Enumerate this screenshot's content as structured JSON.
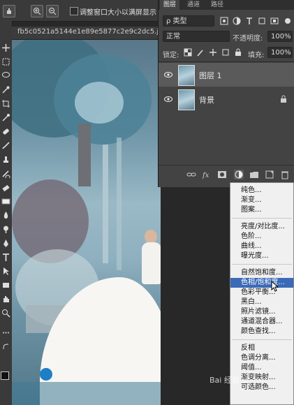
{
  "options_bar": {
    "checkbox_label": "调整窗口大小以满屏显示"
  },
  "document": {
    "tab_title": "fb5c0521a5144e1e89e5877c2e9c2dc5.jpg @"
  },
  "layers_panel": {
    "tabs": [
      "图层",
      "通道",
      "路径"
    ],
    "filter_label": "ρ 类型",
    "blend_mode": "正常",
    "opacity_label": "不透明度:",
    "opacity_value": "100%",
    "lock_label": "锁定:",
    "fill_label": "填充:",
    "fill_value": "100%",
    "layers": [
      {
        "name": "图层 1",
        "selected": true,
        "locked": false
      },
      {
        "name": "背景",
        "selected": false,
        "locked": true
      }
    ]
  },
  "adjustment_menu": {
    "groups": [
      [
        "纯色...",
        "渐变...",
        "图案..."
      ],
      [
        "亮度/对比度...",
        "色阶...",
        "曲线...",
        "曝光度..."
      ],
      [
        "自然饱和度...",
        "色相/饱和度...",
        "色彩平衡...",
        "黑白...",
        "照片滤镜...",
        "通道混合器...",
        "颜色查找..."
      ],
      [
        "反相",
        "色调分离...",
        "阈值...",
        "渐变映射...",
        "可选颜色..."
      ]
    ],
    "highlighted": "色相/饱和度..."
  },
  "watermark": "Bai 经验",
  "colors": {
    "menu_highlight": "#3b6ab7",
    "panel_bg": "#434343"
  }
}
